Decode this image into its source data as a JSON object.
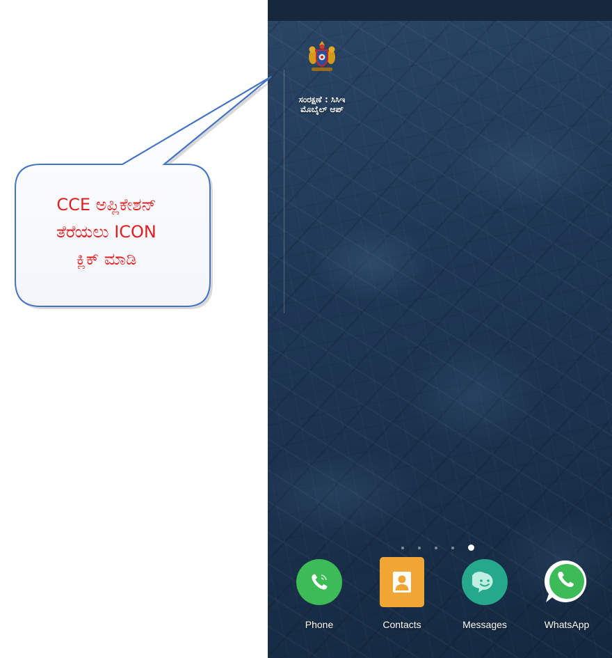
{
  "callout": {
    "text_line1": "CCE ಅಪ್ಲಿಕೇಶನ್",
    "text_line2": "ತೆರೆಯಲು ICON",
    "text_line3": "ಕ್ಲಿಕ್ ಮಾಡಿ",
    "text_color": "#e02020",
    "border_color": "#4472c4"
  },
  "home_screen": {
    "app": {
      "icon": "karnataka-emblem-icon",
      "label_line1": "ಸಂರಕ್ಷಣೆ : ಸಿಸಿಇ",
      "label_line2": "ಮೊಬೈಲ್ ಆಪ್"
    },
    "page_indicator": {
      "total": 5,
      "active": 5
    },
    "dock": [
      {
        "label": "Phone",
        "icon": "phone-icon",
        "color": "#3dbb57"
      },
      {
        "label": "Contacts",
        "icon": "contacts-icon",
        "color": "#f0a634"
      },
      {
        "label": "Messages",
        "icon": "messages-icon",
        "color": "#26a88c"
      },
      {
        "label": "WhatsApp",
        "icon": "whatsapp-icon",
        "color": "#3dbb57"
      }
    ]
  }
}
